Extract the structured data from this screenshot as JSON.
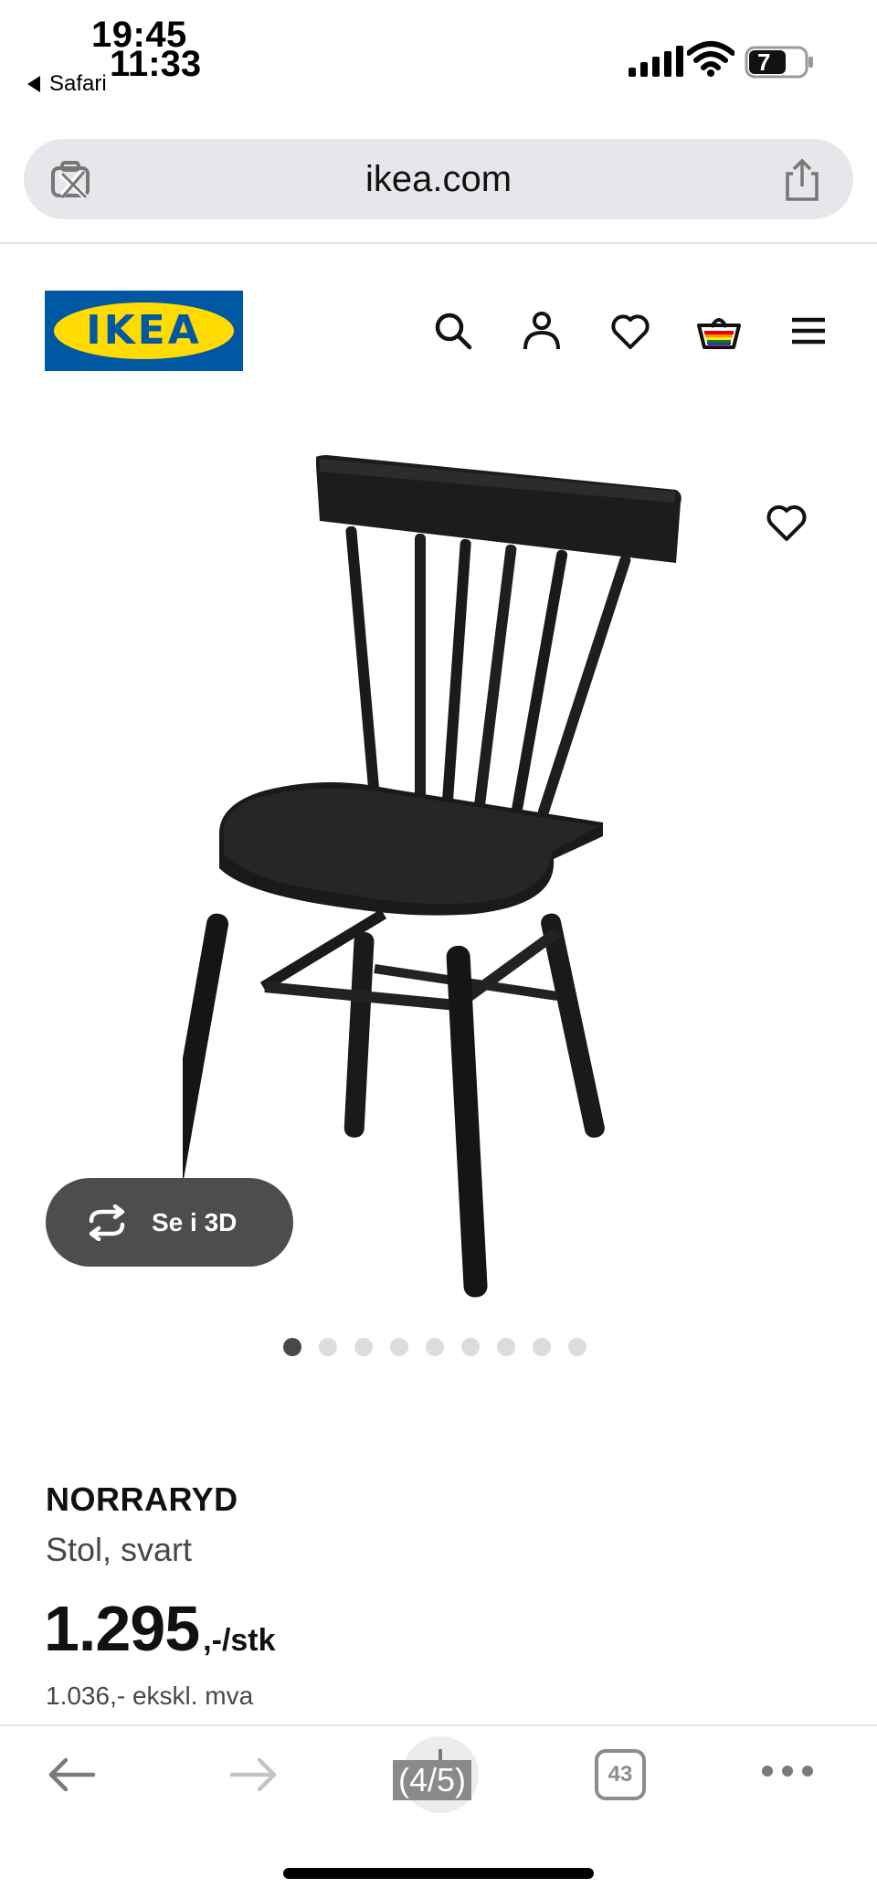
{
  "status_bar": {
    "time_primary": "19:45",
    "time_overlay": "11:33",
    "back_app": "Safari",
    "battery_level": "7"
  },
  "browser": {
    "url": "ikea.com"
  },
  "header": {
    "logo_text": "IKEA",
    "icons": [
      "search-icon",
      "account-icon",
      "favorites-icon",
      "basket-icon",
      "menu-icon"
    ]
  },
  "product": {
    "view_3d_label": "Se i 3D",
    "image_dots_total": 9,
    "image_dot_active": 1,
    "name": "NORRARYD",
    "description": "Stol, svart",
    "price": "1.295",
    "price_unit": ",-/stk",
    "price_ex_vat": "1.036,- ekskl. mva"
  },
  "toolbar": {
    "counter": "(4/5)",
    "tab_count": "43"
  },
  "colors": {
    "ikea_blue": "#0058a3",
    "ikea_yellow": "#ffdb00",
    "address_bar_bg": "#e5e7ea",
    "button_3d_bg": "#4d4d4d"
  }
}
